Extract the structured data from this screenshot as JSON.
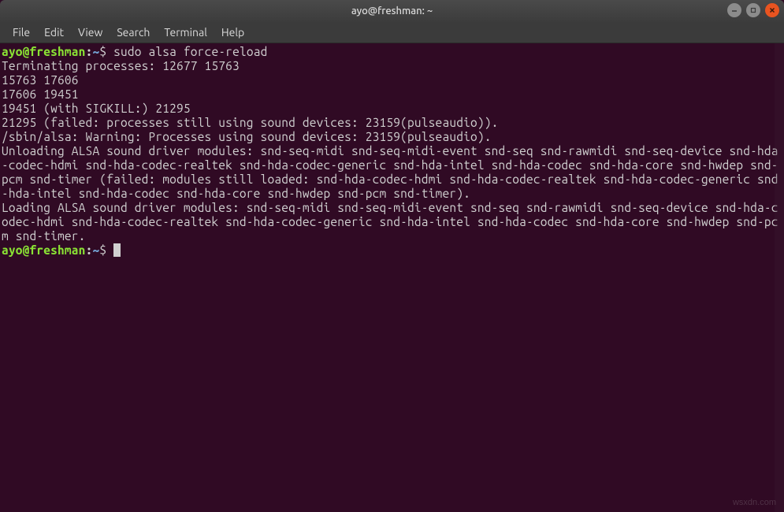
{
  "window": {
    "title": "ayo@freshman: ~"
  },
  "menu": {
    "file": "File",
    "edit": "Edit",
    "view": "View",
    "search": "Search",
    "terminal": "Terminal",
    "help": "Help"
  },
  "prompt": {
    "user_host": "ayo@freshman",
    "colon": ":",
    "path": "~",
    "symbol": "$"
  },
  "command1": "sudo alsa force-reload",
  "output_lines": [
    "Terminating processes: 12677 15763",
    "15763 17606",
    "17606 19451",
    "19451 (with SIGKILL:) 21295",
    "21295 (failed: processes still using sound devices: 23159(pulseaudio)).",
    "/sbin/alsa: Warning: Processes using sound devices: 23159(pulseaudio).",
    "Unloading ALSA sound driver modules: snd-seq-midi snd-seq-midi-event snd-seq snd-rawmidi snd-seq-device snd-hda-codec-hdmi snd-hda-codec-realtek snd-hda-codec-generic snd-hda-intel snd-hda-codec snd-hda-core snd-hwdep snd-pcm snd-timer (failed: modules still loaded: snd-hda-codec-hdmi snd-hda-codec-realtek snd-hda-codec-generic snd-hda-intel snd-hda-codec snd-hda-core snd-hwdep snd-pcm snd-timer).",
    "Loading ALSA sound driver modules: snd-seq-midi snd-seq-midi-event snd-seq snd-rawmidi snd-seq-device snd-hda-codec-hdmi snd-hda-codec-realtek snd-hda-codec-generic snd-hda-intel snd-hda-codec snd-hda-core snd-hwdep snd-pcm snd-timer."
  ],
  "watermark": "wsxdn.com"
}
